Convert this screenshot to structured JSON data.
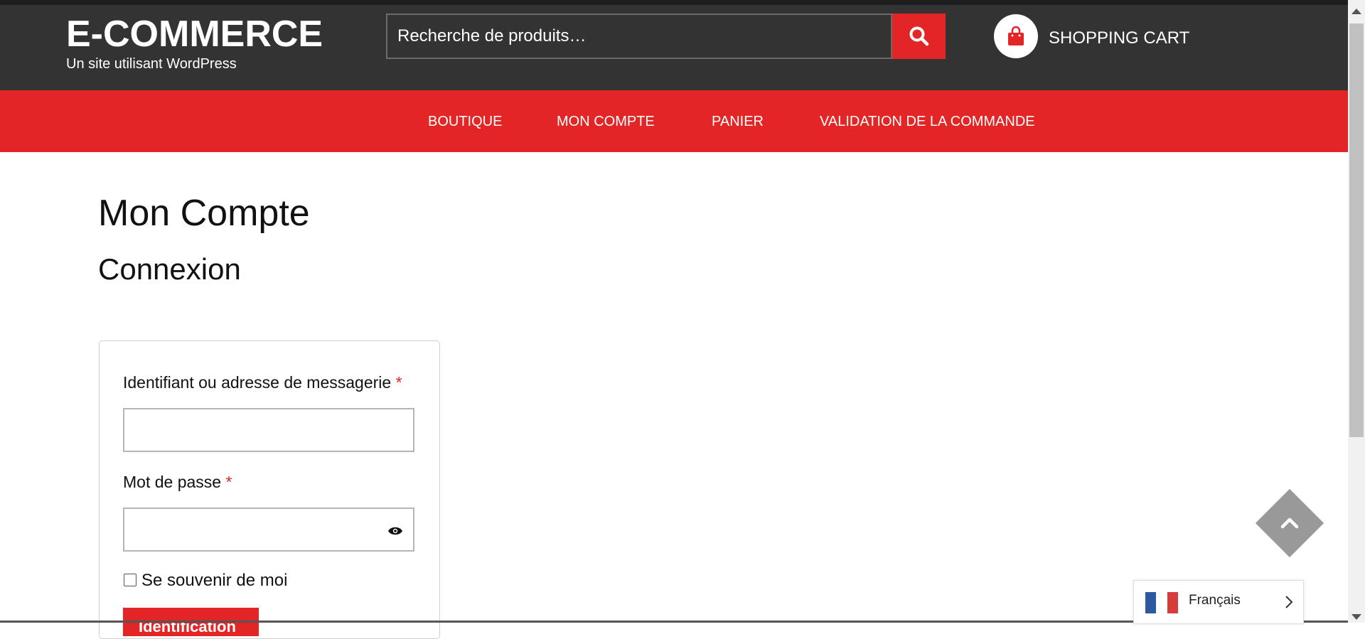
{
  "site": {
    "title": "E-COMMERCE",
    "tagline": "Un site utilisant WordPress"
  },
  "search": {
    "placeholder": "Recherche de produits…",
    "button_icon": "search-icon"
  },
  "cart": {
    "label": "SHOPPING CART",
    "icon": "shopping-bag-icon"
  },
  "nav": {
    "items": [
      "BOUTIQUE",
      "MON COMPTE",
      "PANIER",
      "VALIDATION DE LA COMMANDE"
    ]
  },
  "page": {
    "title": "Mon Compte",
    "section": "Connexion"
  },
  "login": {
    "username_label": "Identifiant ou adresse de messagerie",
    "password_label": "Mot de passe",
    "required_marker": "*",
    "remember_label": "Se souvenir de moi",
    "submit_label": "Identification"
  },
  "language": {
    "label": "Français",
    "flag_colors": [
      "#2b5aa0",
      "#ffffff",
      "#d53c3c"
    ]
  },
  "colors": {
    "header_bg": "#333333",
    "accent": "#e32526",
    "scroll_top_bg": "#999999"
  }
}
